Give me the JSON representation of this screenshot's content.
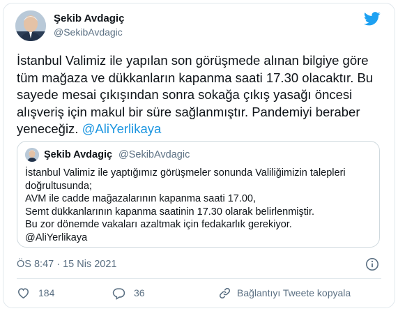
{
  "tweet": {
    "author_name": "Şekib Avdagiç",
    "author_handle": "@SekibAvdagic",
    "text": "İstanbul Valimiz ile yapılan son görüşmede alınan bilgiye göre tüm mağaza ve dükkanların kapanma saati 17.30 olacaktır. Bu sayede mesai çıkışından sonra sokağa çıkış yasağı öncesi alışveriş için makul bir süre sağlanmıştır. Pandemiyi beraber yeneceğiz.",
    "mention": "@AliYerlikaya",
    "timestamp": "ÖS 8:47 · 15 Nis 2021"
  },
  "quoted_tweet": {
    "author_name": "Şekib Avdagiç",
    "author_handle": "@SekibAvdagic",
    "lines": [
      "İstanbul Valimiz ile yaptığımız görüşmeler sonunda Valiliğimizin talepleri",
      "doğrultusunda;",
      "AVM ile cadde mağazalarının kapanma saati 17.00,",
      "Semt dükkanlarının kapanma saatinin 17.30 olarak belirlenmiştir.",
      "Bu zor dönemde vakaları azaltmak için fedakarlık gerekiyor.",
      "@AliYerlikaya"
    ]
  },
  "actions": {
    "likes": "184",
    "replies": "36",
    "copy_link_label": "Bağlantıyı Tweete kopyala"
  },
  "icons": {
    "brand": "twitter-bird-icon",
    "info": "info-icon",
    "like": "heart-icon",
    "reply": "comment-icon",
    "link": "link-icon"
  },
  "colors": {
    "twitter_blue": "#1da1f2",
    "mention_blue": "#1b95e0",
    "secondary_text": "#5b7083",
    "border": "#e1e8ed"
  }
}
